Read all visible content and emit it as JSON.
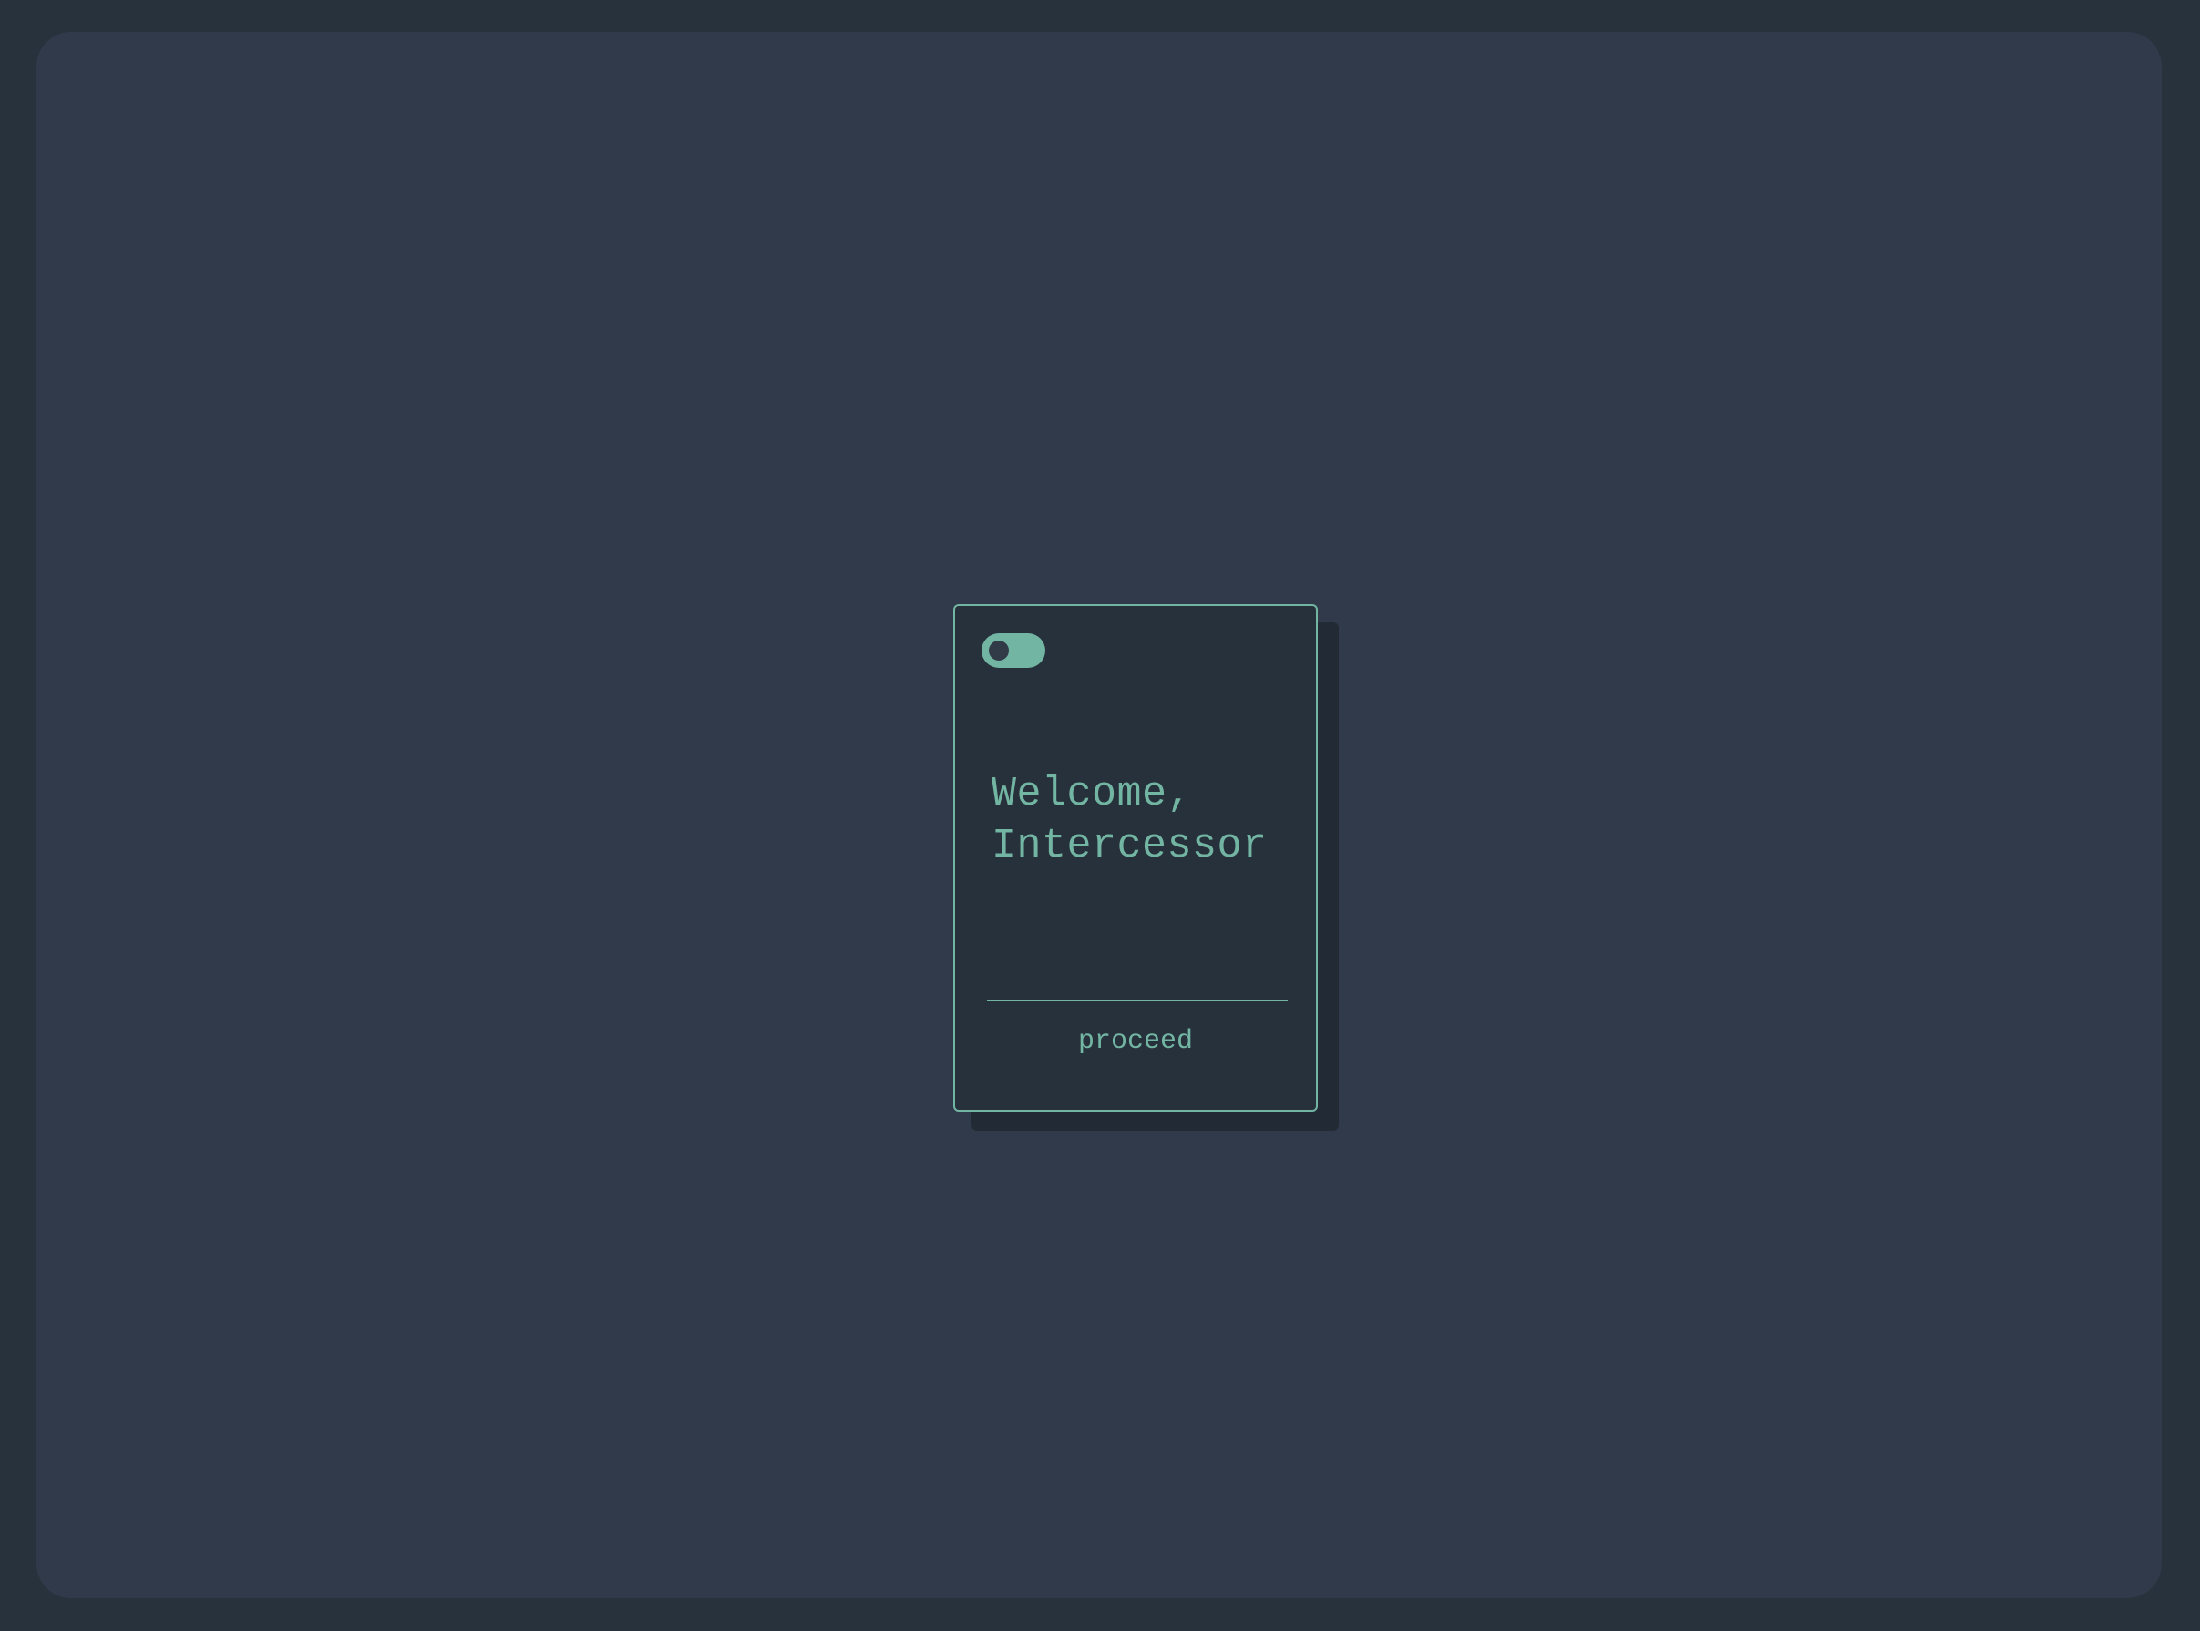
{
  "card": {
    "greeting_line1": "Welcome,",
    "greeting_line2": "Intercessor",
    "toggle": {
      "state": "off",
      "icon": "toggle-switch-icon"
    },
    "proceed_label": "proceed"
  },
  "colors": {
    "background": "#28323c",
    "panel": "#303a4a",
    "card": "#27313b",
    "card_shadow": "#222b35",
    "accent": "#73b5a3"
  }
}
